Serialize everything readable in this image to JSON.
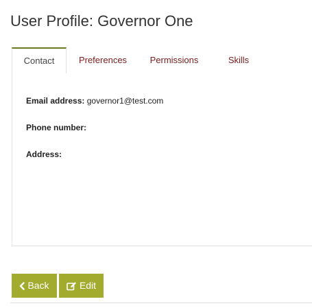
{
  "page": {
    "title": "User Profile: Governor One"
  },
  "tabs": [
    {
      "label": "Contact",
      "active": true
    },
    {
      "label": "Preferences",
      "active": false
    },
    {
      "label": "Permissions",
      "active": false
    },
    {
      "label": "Skills",
      "active": false
    }
  ],
  "contact": {
    "email_label": "Email address:",
    "email_value": "governor1@test.com",
    "phone_label": "Phone number:",
    "phone_value": "",
    "address_label": "Address:",
    "address_value": ""
  },
  "actions": {
    "back_label": "Back",
    "back_icon": "chevron-left-icon",
    "edit_label": "Edit",
    "edit_icon": "edit-icon"
  },
  "colors": {
    "button_bg": "#a3ab2e",
    "tab_link": "#7a1c1c",
    "active_tab_border": "#6b7a1f"
  }
}
